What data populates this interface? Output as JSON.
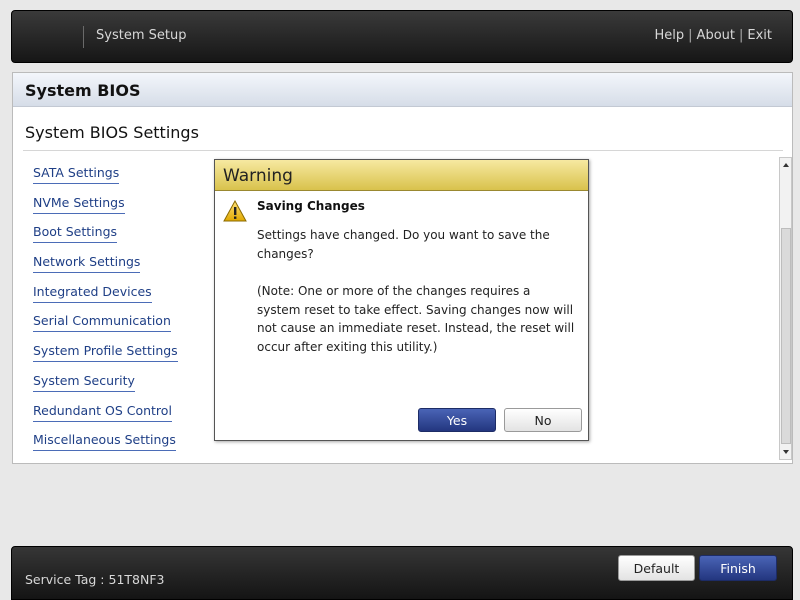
{
  "header": {
    "app_title": "System Setup",
    "links": [
      "Help",
      "About",
      "Exit"
    ],
    "separator": "|"
  },
  "section": {
    "title": "System BIOS",
    "page_title": "System BIOS Settings"
  },
  "settings_items": [
    "SATA Settings",
    "NVMe Settings",
    "Boot Settings",
    "Network Settings",
    "Integrated Devices",
    "Serial Communication",
    "System Profile Settings",
    "System Security",
    "Redundant OS Control",
    "Miscellaneous Settings"
  ],
  "dialog": {
    "title": "Warning",
    "icon": "warning-triangle-icon",
    "subtitle": "Saving Changes",
    "message": "Settings have changed. Do you want to save the changes?",
    "note": "(Note: One or more of the changes requires a system reset to take effect. Saving changes now will not cause an immediate reset. Instead, the reset will occur after exiting this utility.)",
    "yes_label": "Yes",
    "no_label": "No"
  },
  "footer": {
    "service_tag": "Service Tag : 51T8NF3",
    "default_label": "Default",
    "finish_label": "Finish"
  },
  "colors": {
    "accent_blue": "#23367f",
    "warning_header": "#e6d47a",
    "link_blue": "#1f3f86"
  }
}
